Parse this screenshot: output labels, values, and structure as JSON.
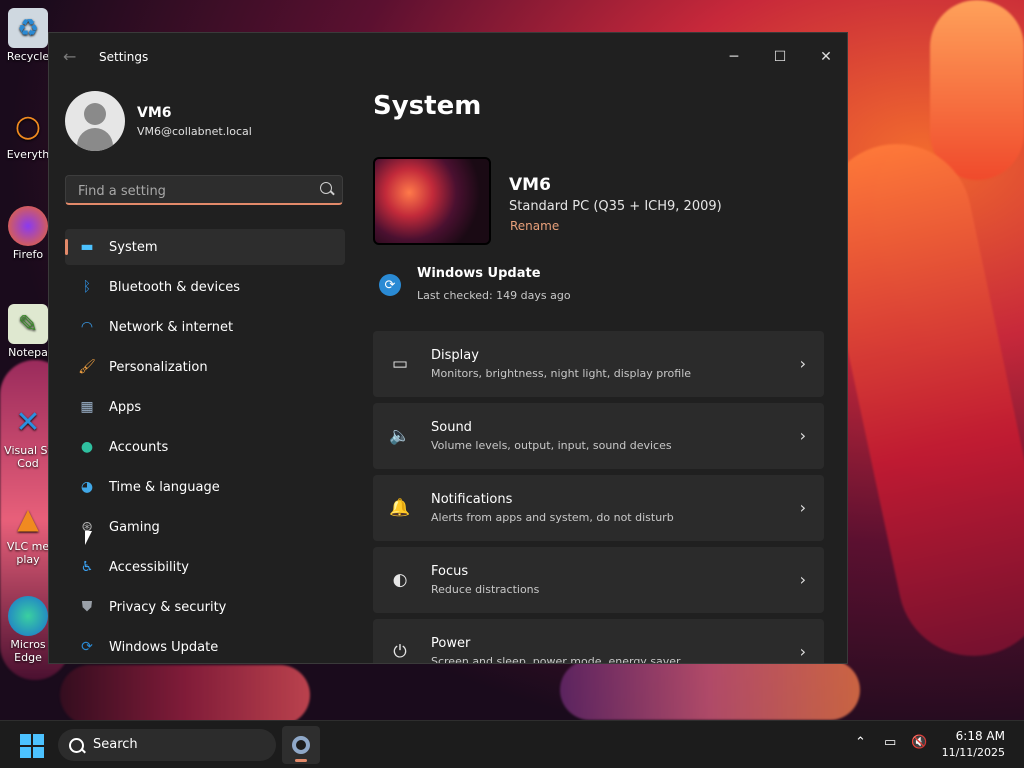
{
  "window": {
    "title": "Settings"
  },
  "user": {
    "name": "VM6",
    "email": "VM6@collabnet.local"
  },
  "search": {
    "placeholder": "Find a setting"
  },
  "nav": [
    {
      "label": "System",
      "icon": "monitor-icon",
      "color": "#4cc2ff"
    },
    {
      "label": "Bluetooth & devices",
      "icon": "bluetooth-icon",
      "color": "#2f8fe0"
    },
    {
      "label": "Network & internet",
      "icon": "wifi-icon",
      "color": "#3a9ae6"
    },
    {
      "label": "Personalization",
      "icon": "brush-icon",
      "color": "#f0a040"
    },
    {
      "label": "Apps",
      "icon": "apps-icon",
      "color": "#9ab0c8"
    },
    {
      "label": "Accounts",
      "icon": "person-icon",
      "color": "#2fc0a0"
    },
    {
      "label": "Time & language",
      "icon": "globe-clock-icon",
      "color": "#40a8e8"
    },
    {
      "label": "Gaming",
      "icon": "gamepad-icon",
      "color": "#b0b0b0"
    },
    {
      "label": "Accessibility",
      "icon": "accessibility-icon",
      "color": "#3aa0f0"
    },
    {
      "label": "Privacy & security",
      "icon": "shield-icon",
      "color": "#9aa0a8"
    },
    {
      "label": "Windows Update",
      "icon": "update-icon",
      "color": "#2a8ad4"
    }
  ],
  "page": {
    "title": "System"
  },
  "device": {
    "name": "VM6",
    "model": "Standard PC (Q35 + ICH9, 2009)",
    "rename_label": "Rename"
  },
  "update": {
    "title": "Windows Update",
    "subtitle": "Last checked: 149 days ago"
  },
  "cards": [
    {
      "title": "Display",
      "subtitle": "Monitors, brightness, night light, display profile",
      "icon": "display-icon"
    },
    {
      "title": "Sound",
      "subtitle": "Volume levels, output, input, sound devices",
      "icon": "speaker-icon"
    },
    {
      "title": "Notifications",
      "subtitle": "Alerts from apps and system, do not disturb",
      "icon": "bell-icon"
    },
    {
      "title": "Focus",
      "subtitle": "Reduce distractions",
      "icon": "focus-icon"
    },
    {
      "title": "Power",
      "subtitle": "Screen and sleep, power mode, energy saver",
      "icon": "power-icon"
    }
  ],
  "desktop_icons": [
    {
      "label": "Recycle",
      "icon": "recycle-bin-icon"
    },
    {
      "label": "Everyth",
      "icon": "search-magnifier-icon"
    },
    {
      "label": "Firefo",
      "icon": "firefox-icon"
    },
    {
      "label": "Notepa",
      "icon": "notepad-icon"
    },
    {
      "label": "Visual St Cod",
      "icon": "vscode-icon"
    },
    {
      "label": "VLC me play",
      "icon": "vlc-icon"
    },
    {
      "label": "Micros Edge",
      "icon": "edge-icon"
    }
  ],
  "taskbar": {
    "search_label": "Search",
    "time": "6:18 AM",
    "date": "11/11/2025"
  },
  "colors": {
    "accent": "#e38a6a",
    "window_bg": "#202020",
    "card_bg": "#2b2b2b"
  }
}
